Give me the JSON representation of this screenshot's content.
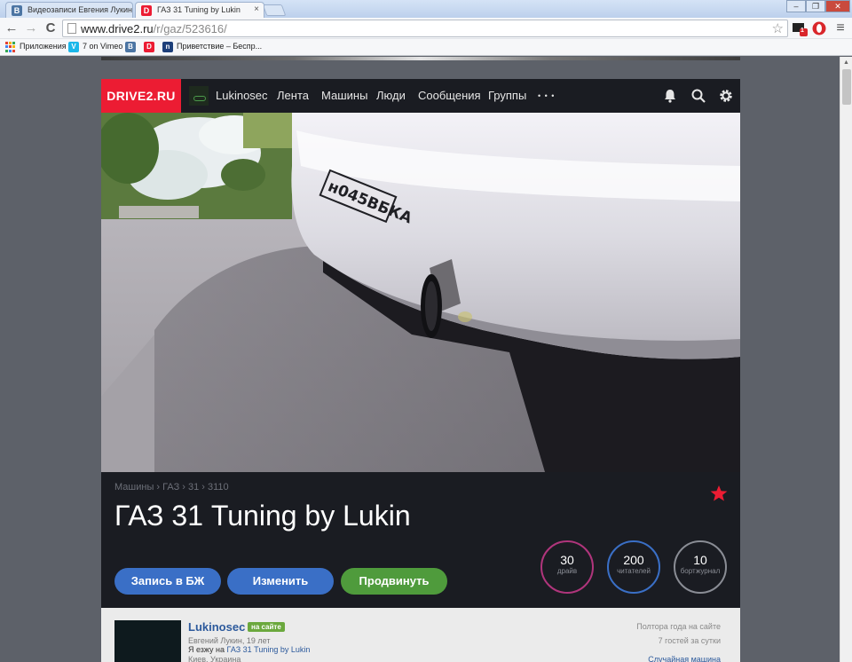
{
  "browser": {
    "tabs": [
      {
        "title": "Видеозаписи Евгения Лукин",
        "favicon": "В",
        "favicon_color": "#4c75a3",
        "active": false
      },
      {
        "title": "ГАЗ 31 Tuning by Lukin",
        "favicon": "D",
        "favicon_color": "#ec1c33",
        "active": true
      }
    ],
    "tab_close": "×",
    "url_host": "www.drive2.ru",
    "url_path": "/r/gaz/523616/",
    "nav": {
      "back": "←",
      "forward": "→",
      "reload": "C",
      "star": "☆",
      "menu": "≡"
    },
    "extension_badge": "1",
    "bookmarks": [
      {
        "label": "Приложения",
        "icon": "apps-grid"
      },
      {
        "label": "7 on Vimeo",
        "icon": "V",
        "color": "#1ab7ea"
      },
      {
        "label": "",
        "icon": "В",
        "color": "#4c75a3"
      },
      {
        "label": "",
        "icon": "D",
        "color": "#ec1c33"
      },
      {
        "label": "Приветствие – Беспр...",
        "icon": "n",
        "color": "#1d3f7a"
      }
    ]
  },
  "site": {
    "logo": "DRIVE2.RU",
    "nav": {
      "user": "Lukinosec",
      "feed": "Лента",
      "cars": "Машины",
      "people": "Люди",
      "messages": "Сообщения",
      "groups": "Группы",
      "more": "• • •"
    },
    "icons": [
      "bell-icon",
      "search-icon",
      "gear-icon"
    ],
    "colors": {
      "brand": "#ec1c33",
      "header": "#1a1c22",
      "button_blue": "#3a6fc6",
      "button_green": "#4f9b3c",
      "star": "#ec1c33"
    }
  },
  "car": {
    "breadcrumbs": "Машины › ГАЗ › 31 › 3110",
    "title": "ГАЗ 31 Tuning by Lukin",
    "plate": "н045ВБКА",
    "buttons": {
      "logbook": "Запись в БЖ",
      "edit": "Изменить",
      "promote": "Продвинуть"
    },
    "stats": [
      {
        "value": "30",
        "label": "драйв",
        "color": "#b0357c"
      },
      {
        "value": "200",
        "label": "читателей",
        "color": "#3a6fc6"
      },
      {
        "value": "10",
        "label": "бортжурнал",
        "color": "#8a8d95"
      }
    ]
  },
  "owner": {
    "name": "Lukinosec",
    "status": "на сайте",
    "info": "Евгений Лукин, 19 лет",
    "drives_prefix": "Я езжу на ",
    "drives_car": "ГАЗ 31 Tuning by Lukin",
    "location": "Киев, Украина",
    "since": "Полтора года на сайте",
    "guests": "7 гостей за сутки",
    "random": "Случайная машина"
  }
}
